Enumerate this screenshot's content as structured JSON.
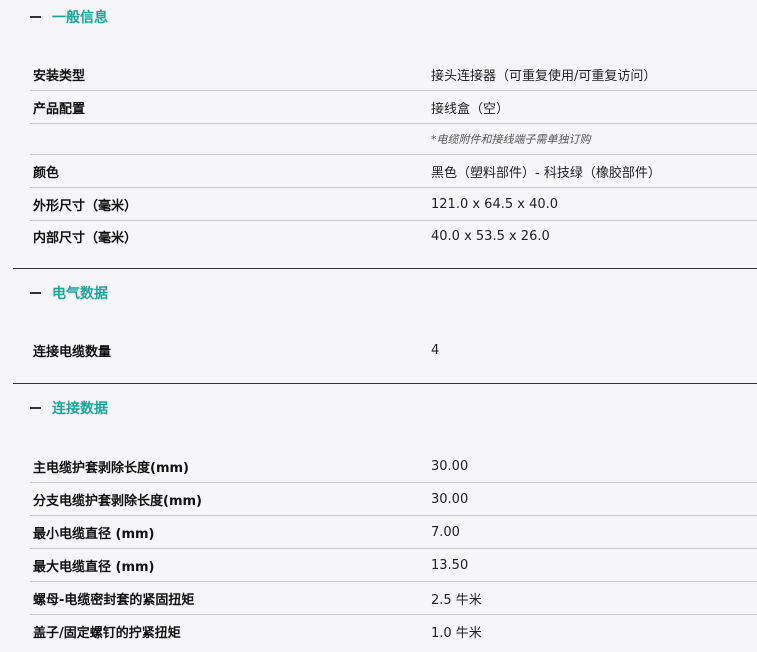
{
  "sections": [
    {
      "title": "一般信息",
      "rows": [
        {
          "label": "安装类型",
          "value": "接头连接器（可重复使用/可重复访问）"
        },
        {
          "label": "产品配置",
          "value": "接线盒（空）"
        },
        {
          "label": "",
          "value": "*电缆附件和接线端子需单独订购"
        },
        {
          "label": "颜色",
          "value": "黑色（塑料部件）- 科技绿（橡胶部件）"
        },
        {
          "label": "外形尺寸（毫米）",
          "value": "121.0 x 64.5 x 40.0"
        },
        {
          "label": "内部尺寸（毫米）",
          "value": "40.0 x 53.5 x 26.0"
        }
      ]
    },
    {
      "title": "电气数据",
      "rows": [
        {
          "label": "连接电缆数量",
          "value": "4"
        }
      ]
    },
    {
      "title": "连接数据",
      "rows": [
        {
          "label": "主电缆护套剥除长度(mm)",
          "value": "30.00"
        },
        {
          "label": "分支电缆护套剥除长度(mm)",
          "value": "30.00"
        },
        {
          "label": "最小电缆直径 (mm)",
          "value": "7.00"
        },
        {
          "label": "最大电缆直径 (mm)",
          "value": "13.50"
        },
        {
          "label": "螺母-电缆密封套的紧固扭矩",
          "value": "2.5 牛米"
        },
        {
          "label": "盖子/固定螺钉的拧紧扭矩",
          "value": "1.0 牛米"
        }
      ]
    }
  ]
}
